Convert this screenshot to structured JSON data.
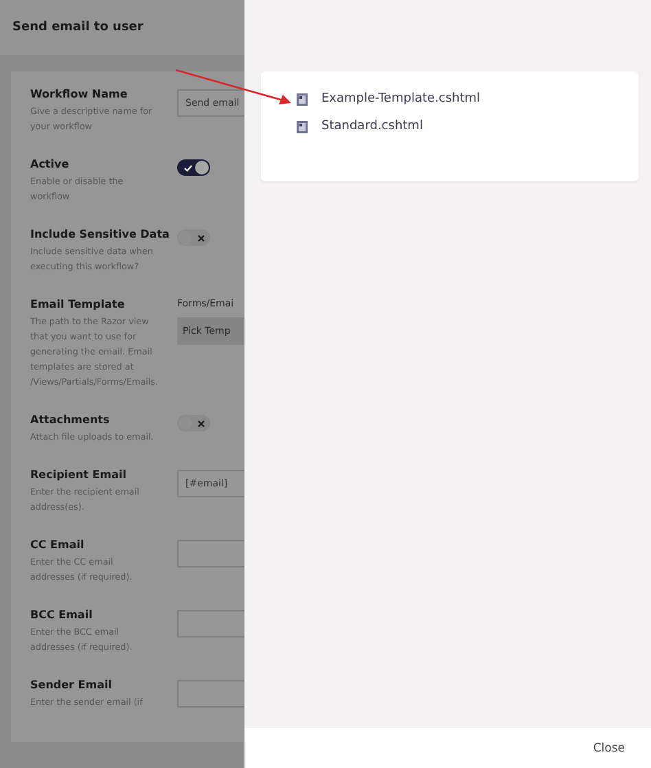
{
  "page": {
    "title": "Send email to user",
    "fields": [
      {
        "kind": "text",
        "label": "Workflow Name",
        "description": "Give a descriptive name for your workflow",
        "value": "Send email"
      },
      {
        "kind": "toggle",
        "label": "Active",
        "description": "Enable or disable the workflow",
        "on": true
      },
      {
        "kind": "toggle",
        "label": "Include Sensitive Data",
        "description": "Include sensitive data when executing this workflow?",
        "on": false
      },
      {
        "kind": "template",
        "label": "Email Template",
        "description": "The path to the Razor view that you want to use for generating the email. Email templates are stored at /Views/Partials/Forms/Emails.",
        "value": "Forms/Emai",
        "button": "Pick Temp"
      },
      {
        "kind": "toggle",
        "label": "Attachments",
        "description": "Attach file uploads to email.",
        "on": false
      },
      {
        "kind": "text",
        "label": "Recipient Email",
        "description": "Enter the recipient email address(es).",
        "value": "[#email]"
      },
      {
        "kind": "text",
        "label": "CC Email",
        "description": "Enter the CC email addresses (if required)."
      },
      {
        "kind": "text",
        "label": "BCC Email",
        "description": "Enter the BCC email addresses (if required)."
      },
      {
        "kind": "text",
        "label": "Sender Email",
        "description": "Enter the sender email (if"
      }
    ]
  },
  "picker": {
    "files": [
      {
        "name": "Example-Template.cshtml"
      },
      {
        "name": "Standard.cshtml"
      }
    ],
    "close": "Close"
  }
}
